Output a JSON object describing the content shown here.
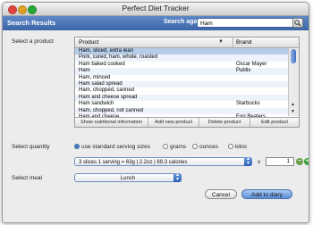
{
  "window": {
    "title": "Perfect Diet Tracker"
  },
  "searchbar": {
    "section_title": "Search Results",
    "search_again_label": "Search again",
    "query": "Ham"
  },
  "product_section": {
    "label": "Select a product",
    "columns": [
      "Product",
      "Brand"
    ],
    "rows": [
      {
        "product": "Ham, sliced, extra lean",
        "brand": ""
      },
      {
        "product": "Pork, cured, ham, whole, roasted",
        "brand": ""
      },
      {
        "product": "Ham baked cooked",
        "brand": "Oscar Mayer"
      },
      {
        "product": "Ham",
        "brand": "Publix"
      },
      {
        "product": "Ham, minced",
        "brand": ""
      },
      {
        "product": "Ham salad spread",
        "brand": ""
      },
      {
        "product": "Ham, chopped, canned",
        "brand": ""
      },
      {
        "product": "Ham and cheese spread",
        "brand": ""
      },
      {
        "product": "Ham sandwich",
        "brand": "Starbucks"
      },
      {
        "product": "Ham, chopped, not canned",
        "brand": ""
      },
      {
        "product": "Ham and cheese",
        "brand": "Egg Beaters"
      }
    ],
    "selected_row": 0,
    "buttons": [
      "Show nutritional information",
      "Add new product",
      "Delete product",
      "Edit product"
    ]
  },
  "quantity": {
    "label": "Select quantity",
    "options": [
      "use standard serving sizes",
      "grams",
      "ounces",
      "kilos"
    ],
    "selected_option": "use standard serving sizes",
    "serving": "3 slices 1 serving = 63g | 2.2oz | 69.3 calories",
    "multiply": "x",
    "amount": "1"
  },
  "meal": {
    "label": "Select meal",
    "value": "Lunch"
  },
  "actions": {
    "cancel": "Cancel",
    "add": "Add to diary"
  },
  "colors": {
    "accent": "#3c66a8",
    "selection": "#b6cde9",
    "add_icon": "#3a9f3a",
    "remove_icon": "#6a9e4a"
  }
}
